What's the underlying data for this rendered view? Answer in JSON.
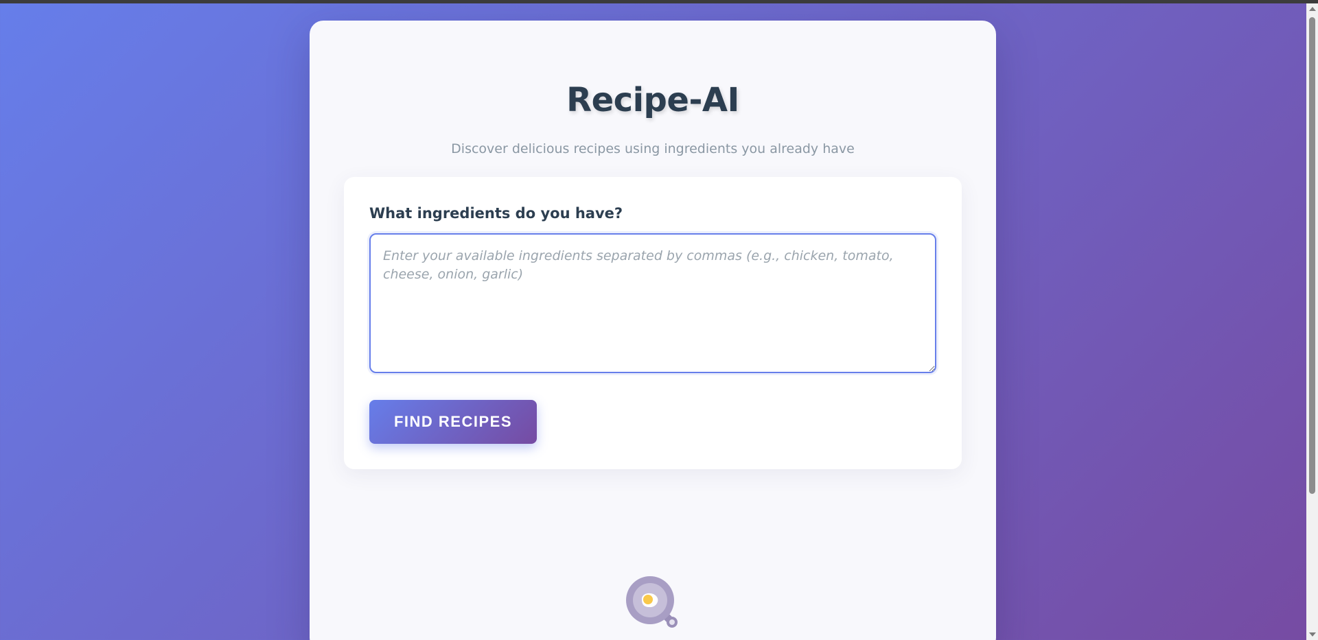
{
  "app": {
    "title": "Recipe-AI",
    "subtitle": "Discover delicious recipes using ingredients you already have"
  },
  "ingredients_form": {
    "label": "What ingredients do you have?",
    "value": "",
    "placeholder": "Enter your available ingredients separated by commas (e.g., chicken, tomato, cheese, onion, garlic)",
    "submit_label": "FIND RECIPES"
  },
  "decor": {
    "illustration_icon": "frying-pan-egg-icon"
  },
  "theme": {
    "gradient_start": "#667eea",
    "gradient_end": "#764ba2",
    "title_color": "#2c3e50",
    "subtitle_color": "#8a97a3",
    "card_background": "#f8f8fc"
  }
}
